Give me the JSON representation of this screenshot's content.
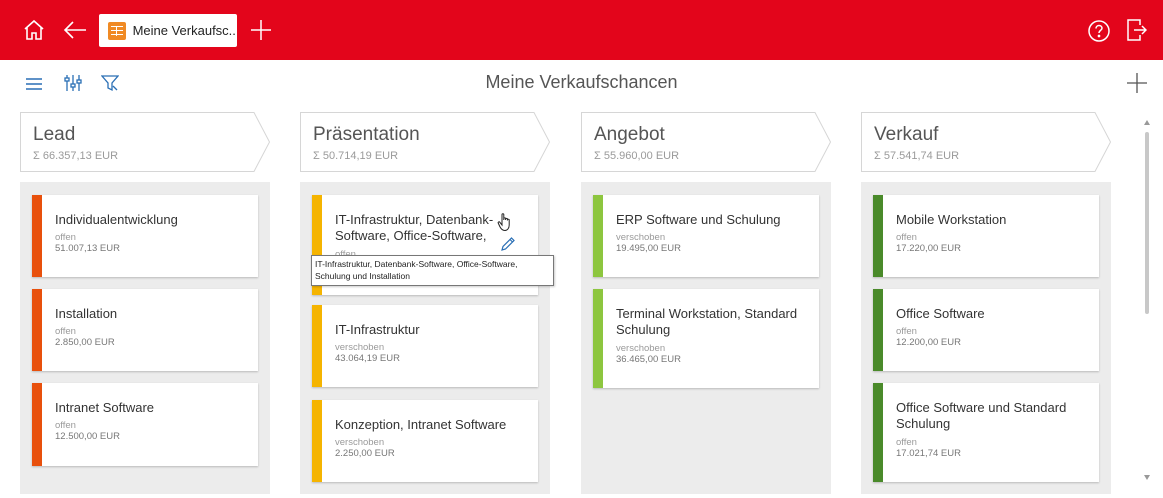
{
  "header": {
    "tab_label": "Meine Verkaufsc...",
    "accent_color": "#e3051b",
    "icons": [
      "home-icon",
      "back-arrow-icon",
      "table-icon",
      "plus-icon",
      "help-icon",
      "logout-icon"
    ]
  },
  "toolbar": {
    "title": "Meine Verkaufschancen",
    "icons": [
      "menu-icon",
      "settings-sliders-icon",
      "filter-icon",
      "add-icon"
    ]
  },
  "columns": [
    {
      "name": "Lead",
      "sum": "Σ 66.357,13 EUR",
      "color": "#e8500c",
      "cards": [
        {
          "title": "Individualentwicklung",
          "status": "offen",
          "amount": "51.007,13 EUR"
        },
        {
          "title": "Installation",
          "status": "offen",
          "amount": "2.850,00 EUR"
        },
        {
          "title": "Intranet Software",
          "status": "offen",
          "amount": "12.500,00 EUR"
        }
      ]
    },
    {
      "name": "Präsentation",
      "sum": "Σ 50.714,19 EUR",
      "color": "#f5b400",
      "cards": [
        {
          "title": "IT-Infrastruktur, Datenbank-Software, Office-Software,",
          "status": "offen",
          "amount": ""
        },
        {
          "title": "IT-Infrastruktur",
          "status": "verschoben",
          "amount": "43.064,19 EUR"
        },
        {
          "title": "Konzeption, Intranet Software",
          "status": "verschoben",
          "amount": "2.250,00 EUR"
        }
      ]
    },
    {
      "name": "Angebot",
      "sum": "Σ 55.960,00 EUR",
      "color": "#8dc63f",
      "cards": [
        {
          "title": "ERP Software und Schulung",
          "status": "verschoben",
          "amount": "19.495,00 EUR"
        },
        {
          "title": "Terminal Workstation, Standard Schulung",
          "status": "verschoben",
          "amount": "36.465,00 EUR"
        }
      ]
    },
    {
      "name": "Verkauf",
      "sum": "Σ 57.541,74 EUR",
      "color": "#4a8a2a",
      "cards": [
        {
          "title": "Mobile Workstation",
          "status": "offen",
          "amount": "17.220,00 EUR"
        },
        {
          "title": "Office Software",
          "status": "offen",
          "amount": "12.200,00 EUR"
        },
        {
          "title": "Office Software und Standard Schulung",
          "status": "offen",
          "amount": "17.021,74 EUR"
        }
      ]
    }
  ],
  "tooltip": {
    "text": "IT-Infrastruktur, Datenbank-Software, Office-Software, Schulung und Installation"
  }
}
